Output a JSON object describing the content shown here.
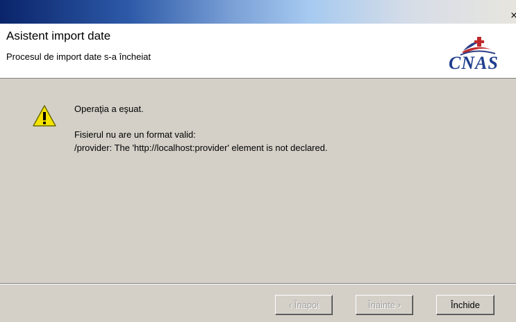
{
  "titlebar": {
    "close_glyph": "×"
  },
  "header": {
    "title": "Asistent import date",
    "subtitle": "Procesul de import date s-a încheiat",
    "logo_text": "CNAS",
    "logo_colors": {
      "text": "#1f3f8e",
      "swoosh": "#c0292b",
      "roof": "#2c3e87"
    }
  },
  "message": {
    "icon": "warning-icon",
    "heading": "Operaţia a eşuat.",
    "line1": "Fisierul nu are un format valid:",
    "line2": "/provider: The 'http://localhost:provider' element is not declared."
  },
  "buttons": {
    "back_label": "‹ Înapoi",
    "next_label": "Înainte ›",
    "close_label": "Închide"
  }
}
